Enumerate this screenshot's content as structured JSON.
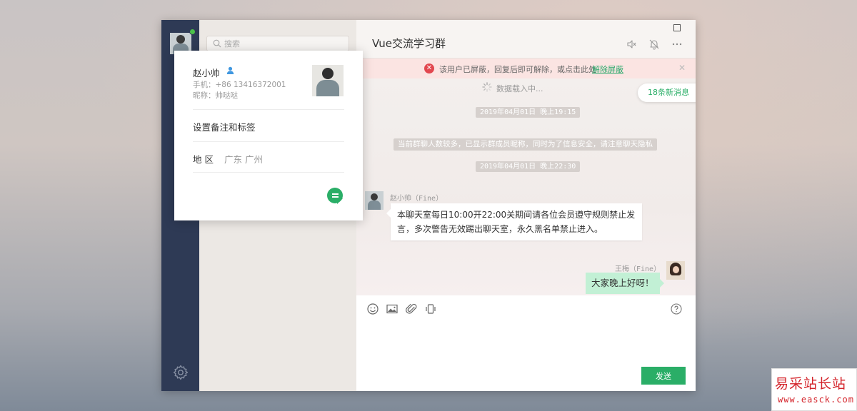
{
  "search": {
    "placeholder": "搜索"
  },
  "chat": {
    "title": "Vue交流学习群",
    "blocked_notice": "该用户已屏蔽，回复后即可解除，或点击此处",
    "unblock_link": "解除屏蔽",
    "loading_text": "数据载入中...",
    "new_messages": "18条新消息",
    "system_notice": "当前群聊人数较多，已显示群成员昵称，同时为了信息安全，请注意聊天隐私",
    "timestamps": [
      "2019年04月01日 晚上19:15",
      "2019年04月01日 晚上22:30"
    ],
    "messages": [
      {
        "sender": "赵小帅（Fine）",
        "text": "本聊天室每日10:00开22:00关期间请各位会员遵守规则禁止发言，多次警告无效踢出聊天室，永久黑名单禁止进入。"
      },
      {
        "sender": "王梅（Fine）",
        "text": "大家晚上好呀！"
      }
    ],
    "send_label": "发送"
  },
  "profile": {
    "name": "赵小帅",
    "phone": "手机：+86 13416372001",
    "nickname": "昵称：帅哒哒",
    "remark_label": "设置备注和标签",
    "region_label": "地 区",
    "region_value": "广东 广州"
  },
  "watermark": {
    "brand": "易采站长站",
    "url": "www.easck.com"
  },
  "colors": {
    "accent": "#2aae67",
    "nav": "#2e3a55",
    "alert": "#e2474f",
    "bubble_self": "#c2f0d5"
  }
}
